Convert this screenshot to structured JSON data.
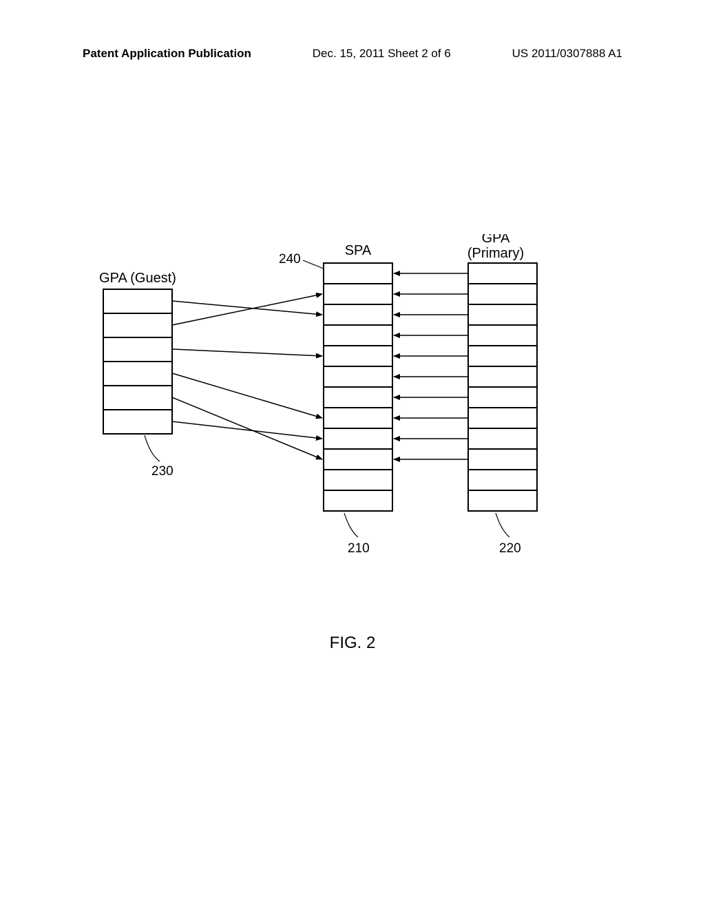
{
  "header": {
    "left": "Patent Application Publication",
    "center": "Dec. 15, 2011  Sheet 2 of 6",
    "right": "US 2011/0307888 A1"
  },
  "labels": {
    "guest": "GPA (Guest)",
    "spa": "SPA",
    "primary_line1": "GPA",
    "primary_line2": "(Primary)"
  },
  "callouts": {
    "guest_ref": "230",
    "spa_ref": "210",
    "primary_ref": "220",
    "arrow_ref": "240"
  },
  "figure_caption": "FIG. 2",
  "chart_data": {
    "type": "diagram",
    "description": "Memory address translation mapping between guest physical addresses, system physical addresses, and primary guest physical addresses",
    "blocks": [
      {
        "id": "gpa_guest",
        "ref": "230",
        "label": "GPA (Guest)",
        "cells": 6
      },
      {
        "id": "spa",
        "ref": "210",
        "label": "SPA",
        "cells": 12
      },
      {
        "id": "gpa_primary",
        "ref": "220",
        "label": "GPA (Primary)",
        "cells": 12
      }
    ],
    "guest_to_spa_edges": [
      {
        "guest_index": 0,
        "spa_index": 2
      },
      {
        "guest_index": 1,
        "spa_index": 1
      },
      {
        "guest_index": 2,
        "spa_index": 4
      },
      {
        "guest_index": 3,
        "spa_index": 7
      },
      {
        "guest_index": 4,
        "spa_index": 9
      },
      {
        "guest_index": 5,
        "spa_index": 8
      }
    ],
    "primary_to_spa_edges": [
      {
        "primary_index": 0,
        "spa_index": 0
      },
      {
        "primary_index": 1,
        "spa_index": 1
      },
      {
        "primary_index": 2,
        "spa_index": 2
      },
      {
        "primary_index": 3,
        "spa_index": 3
      },
      {
        "primary_index": 4,
        "spa_index": 4
      },
      {
        "primary_index": 5,
        "spa_index": 5
      },
      {
        "primary_index": 6,
        "spa_index": 6
      },
      {
        "primary_index": 7,
        "spa_index": 7
      },
      {
        "primary_index": 8,
        "spa_index": 8
      },
      {
        "primary_index": 9,
        "spa_index": 9
      }
    ],
    "callout_240_points_to": {
      "block": "spa",
      "cell_index": 0
    }
  }
}
